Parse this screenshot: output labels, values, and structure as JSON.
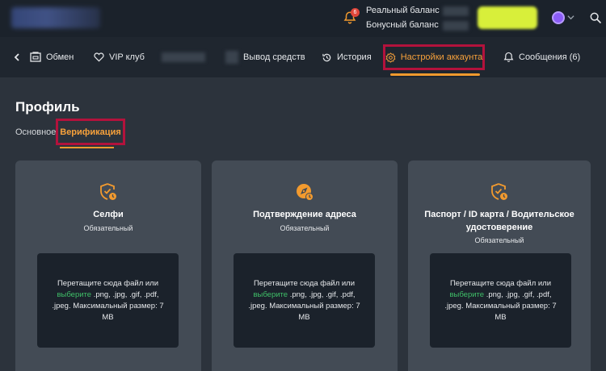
{
  "header": {
    "notification_count": "6",
    "balance_real_label": "Реальный баланс",
    "balance_bonus_label": "Бонусный баланс"
  },
  "nav": {
    "exchange": "Обмен",
    "vip": "VIP клуб",
    "withdraw": "Вывод средств",
    "history": "История",
    "settings": "Настройки аккаунта",
    "messages": "Сообщения (6)"
  },
  "profile": {
    "title": "Профиль",
    "tab_basic": "Основное",
    "tab_verification": "Верификация"
  },
  "cards": [
    {
      "title": "Селфи",
      "status": "Обязательный",
      "drop_text_before": "Перетащите сюда файл или ",
      "drop_link": "выберите",
      "drop_text_after": " .png, .jpg, .gif, .pdf, .jpeg. Максимальный размер: 7 MB"
    },
    {
      "title": "Подтверждение адреса",
      "status": "Обязательный",
      "drop_text_before": "Перетащите сюда файл или ",
      "drop_link": "выберите",
      "drop_text_after": " .png, .jpg, .gif, .pdf, .jpeg. Максимальный размер: 7 MB"
    },
    {
      "title": "Паспорт / ID карта / Водительское удостоверение",
      "status": "Обязательный",
      "drop_text_before": "Перетащите сюда файл или ",
      "drop_link": "выберите",
      "drop_text_after": " .png, .jpg, .gif, .pdf, .jpeg. Максимальный размер: 7 MB"
    }
  ],
  "colors": {
    "accent": "#f29a2e",
    "highlight_border": "#b3123c",
    "link": "#3fbf68",
    "deposit": "#d8ef3a"
  }
}
